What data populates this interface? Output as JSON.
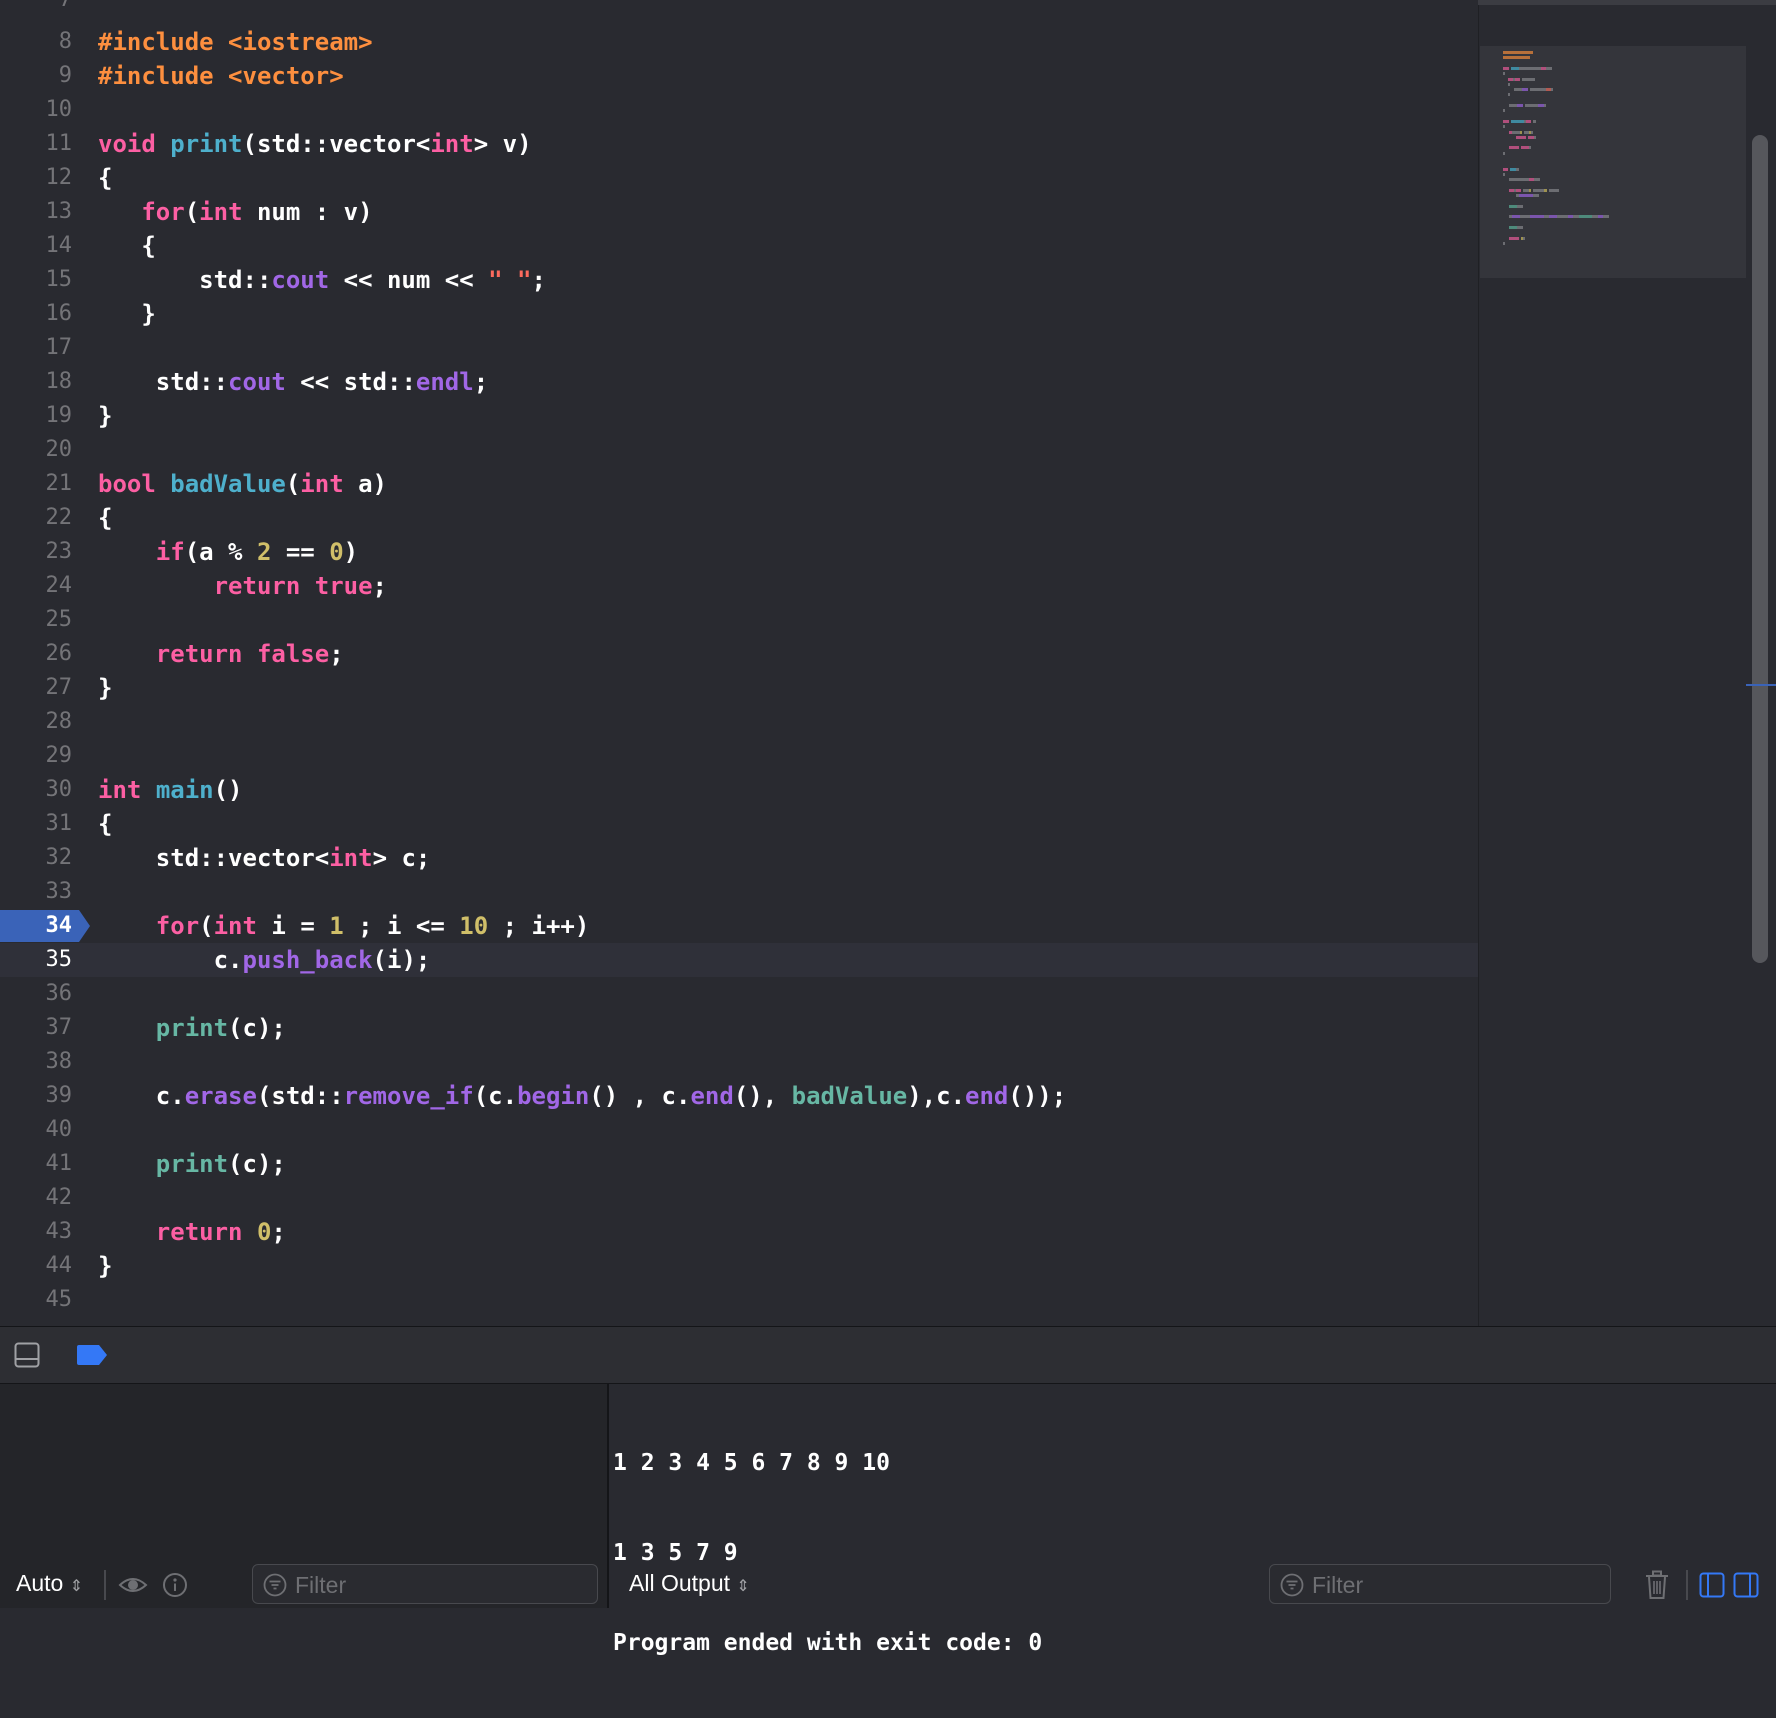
{
  "editor": {
    "first_partial_line_number": "7",
    "current_line": 35,
    "breakpoint_line": 34,
    "lines": [
      {
        "n": "8",
        "t": [
          [
            "pp",
            "#include <iostream>"
          ]
        ]
      },
      {
        "n": "9",
        "t": [
          [
            "pp",
            "#include <vector>"
          ]
        ]
      },
      {
        "n": "10",
        "t": []
      },
      {
        "n": "11",
        "t": [
          [
            "kw",
            "void"
          ],
          [
            "pl",
            " "
          ],
          [
            "fn2",
            "print"
          ],
          [
            "pl",
            "(std::"
          ],
          [
            "pl",
            "vector"
          ],
          [
            "pl",
            "<"
          ],
          [
            "kw",
            "int"
          ],
          [
            "pl",
            "> v)"
          ]
        ]
      },
      {
        "n": "12",
        "t": [
          [
            "pl",
            "{"
          ]
        ]
      },
      {
        "n": "13",
        "t": [
          [
            "pl",
            "   "
          ],
          [
            "kw",
            "for"
          ],
          [
            "pl",
            "("
          ],
          [
            "kw",
            "int"
          ],
          [
            "pl",
            " num : v)"
          ]
        ]
      },
      {
        "n": "14",
        "t": [
          [
            "pl",
            "   {"
          ]
        ]
      },
      {
        "n": "15",
        "t": [
          [
            "pl",
            "       std::"
          ],
          [
            "type",
            "cout"
          ],
          [
            "pl",
            " << num << "
          ],
          [
            "str",
            "\" \""
          ],
          [
            "pl",
            ";"
          ]
        ]
      },
      {
        "n": "16",
        "t": [
          [
            "pl",
            "   }"
          ]
        ]
      },
      {
        "n": "17",
        "t": []
      },
      {
        "n": "18",
        "t": [
          [
            "pl",
            "    std::"
          ],
          [
            "type",
            "cout"
          ],
          [
            "pl",
            " << std::"
          ],
          [
            "type",
            "endl"
          ],
          [
            "pl",
            ";"
          ]
        ]
      },
      {
        "n": "19",
        "t": [
          [
            "pl",
            "}"
          ]
        ]
      },
      {
        "n": "20",
        "t": []
      },
      {
        "n": "21",
        "t": [
          [
            "kw",
            "bool"
          ],
          [
            "pl",
            " "
          ],
          [
            "fn2",
            "badValue"
          ],
          [
            "pl",
            "("
          ],
          [
            "kw",
            "int"
          ],
          [
            "pl",
            " a)"
          ]
        ]
      },
      {
        "n": "22",
        "t": [
          [
            "pl",
            "{"
          ]
        ]
      },
      {
        "n": "23",
        "t": [
          [
            "pl",
            "    "
          ],
          [
            "kw",
            "if"
          ],
          [
            "pl",
            "(a % "
          ],
          [
            "num",
            "2"
          ],
          [
            "pl",
            " == "
          ],
          [
            "num",
            "0"
          ],
          [
            "pl",
            ")"
          ]
        ]
      },
      {
        "n": "24",
        "t": [
          [
            "pl",
            "        "
          ],
          [
            "kw",
            "return"
          ],
          [
            "pl",
            " "
          ],
          [
            "kw",
            "true"
          ],
          [
            "pl",
            ";"
          ]
        ]
      },
      {
        "n": "25",
        "t": []
      },
      {
        "n": "26",
        "t": [
          [
            "pl",
            "    "
          ],
          [
            "kw",
            "return"
          ],
          [
            "pl",
            " "
          ],
          [
            "kw",
            "false"
          ],
          [
            "pl",
            ";"
          ]
        ]
      },
      {
        "n": "27",
        "t": [
          [
            "pl",
            "}"
          ]
        ]
      },
      {
        "n": "28",
        "t": []
      },
      {
        "n": "29",
        "t": []
      },
      {
        "n": "30",
        "t": [
          [
            "kw",
            "int"
          ],
          [
            "pl",
            " "
          ],
          [
            "fn2",
            "main"
          ],
          [
            "pl",
            "()"
          ]
        ]
      },
      {
        "n": "31",
        "t": [
          [
            "pl",
            "{"
          ]
        ]
      },
      {
        "n": "32",
        "t": [
          [
            "pl",
            "    std::"
          ],
          [
            "pl",
            "vector"
          ],
          [
            "pl",
            "<"
          ],
          [
            "kw",
            "int"
          ],
          [
            "pl",
            "> c;"
          ]
        ]
      },
      {
        "n": "33",
        "t": []
      },
      {
        "n": "34",
        "t": [
          [
            "pl",
            "    "
          ],
          [
            "kw",
            "for"
          ],
          [
            "pl",
            "("
          ],
          [
            "kw",
            "int"
          ],
          [
            "pl",
            " i = "
          ],
          [
            "num",
            "1"
          ],
          [
            "pl",
            " ; i <= "
          ],
          [
            "num",
            "10"
          ],
          [
            "pl",
            " ; i++)"
          ]
        ]
      },
      {
        "n": "35",
        "t": [
          [
            "pl",
            "        c."
          ],
          [
            "type",
            "push_back"
          ],
          [
            "pl",
            "(i);"
          ]
        ]
      },
      {
        "n": "36",
        "t": []
      },
      {
        "n": "37",
        "t": [
          [
            "pl",
            "    "
          ],
          [
            "fn",
            "print"
          ],
          [
            "pl",
            "(c);"
          ]
        ]
      },
      {
        "n": "38",
        "t": []
      },
      {
        "n": "39",
        "t": [
          [
            "pl",
            "    c."
          ],
          [
            "type",
            "erase"
          ],
          [
            "pl",
            "(std::"
          ],
          [
            "type",
            "remove_if"
          ],
          [
            "pl",
            "(c."
          ],
          [
            "type",
            "begin"
          ],
          [
            "pl",
            "() , c."
          ],
          [
            "type",
            "end"
          ],
          [
            "pl",
            "(), "
          ],
          [
            "fn",
            "badValue"
          ],
          [
            "pl",
            "),c."
          ],
          [
            "type",
            "end"
          ],
          [
            "pl",
            "());"
          ]
        ]
      },
      {
        "n": "40",
        "t": []
      },
      {
        "n": "41",
        "t": [
          [
            "pl",
            "    "
          ],
          [
            "fn",
            "print"
          ],
          [
            "pl",
            "(c);"
          ]
        ]
      },
      {
        "n": "42",
        "t": []
      },
      {
        "n": "43",
        "t": [
          [
            "pl",
            "    "
          ],
          [
            "kw",
            "return"
          ],
          [
            "pl",
            " "
          ],
          [
            "num",
            "0"
          ],
          [
            "pl",
            ";"
          ]
        ]
      },
      {
        "n": "44",
        "t": [
          [
            "pl",
            "}"
          ]
        ]
      },
      {
        "n": "45",
        "t": []
      }
    ]
  },
  "colors": {
    "keyword": "#fc5fa3",
    "preprocessor": "#fd8f3f",
    "number": "#d0bf69",
    "string": "#fc6a5d",
    "type_member": "#a167e6",
    "function": "#67b7a4",
    "breakpoint": "#3a63b8"
  },
  "console": {
    "output_lines": [
      "1 2 3 4 5 6 7 8 9 10",
      "1 3 5 7 9",
      "Program ended with exit code: 0"
    ],
    "output_scope": "All Output",
    "filter_placeholder": "Filter"
  },
  "variables": {
    "scope": "Auto",
    "filter_placeholder": "Filter"
  },
  "icons": {
    "toggle_console": "panel-bottom-icon",
    "breakpoints": "breakpoint-tag-icon",
    "quick_look": "eye-icon",
    "info": "info-icon",
    "trash": "trash-icon",
    "left_panel": "left-panel-icon",
    "right_panel": "right-panel-icon"
  }
}
